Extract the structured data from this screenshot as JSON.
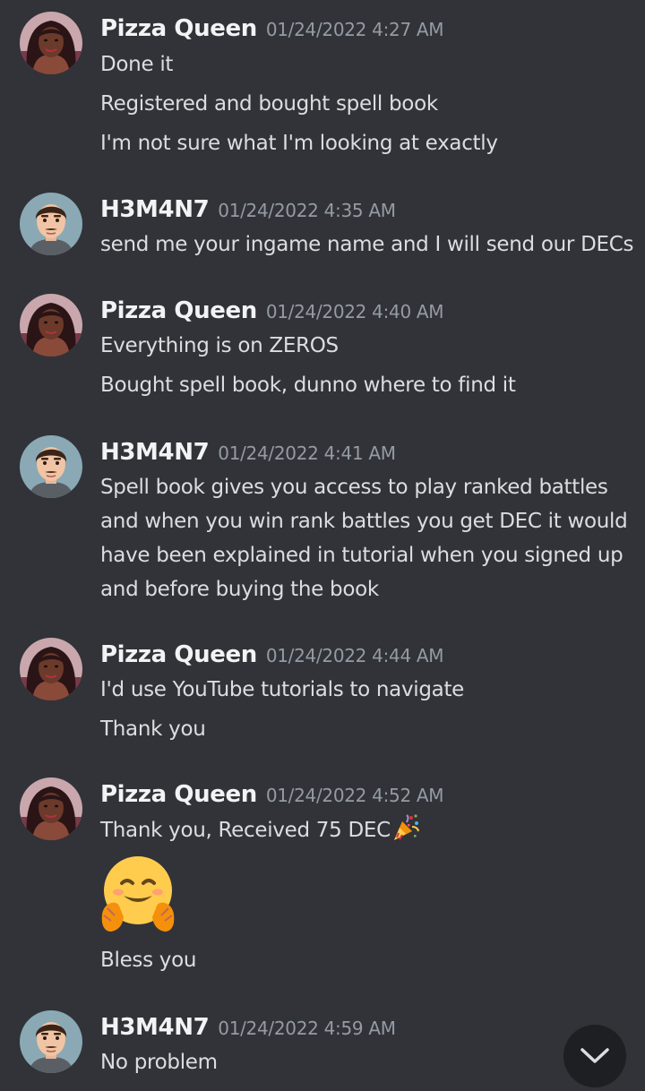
{
  "messages": [
    {
      "user": "Pizza Queen",
      "avatar": "woman-avatar",
      "timestamp": "01/24/2022 4:27 AM",
      "lines": [
        "Done it",
        "Registered and bought spell book",
        "I'm not sure what I'm looking at exactly"
      ]
    },
    {
      "user": "H3M4N7",
      "avatar": "man-avatar",
      "timestamp": "01/24/2022 4:35 AM",
      "lines": [
        "send me your ingame name and I will send our DECs"
      ]
    },
    {
      "user": "Pizza Queen",
      "avatar": "woman-avatar",
      "timestamp": "01/24/2022 4:40 AM",
      "lines": [
        "Everything is on ZEROS",
        "Bought spell book, dunno where to find it"
      ]
    },
    {
      "user": "H3M4N7",
      "avatar": "man-avatar",
      "timestamp": "01/24/2022 4:41 AM",
      "lines": [
        "Spell book gives you access to play ranked battles",
        "and when you win rank battles you get DEC it would",
        "have been explained in tutorial when you signed up",
        "and before buying the book"
      ]
    },
    {
      "user": "Pizza Queen",
      "avatar": "woman-avatar",
      "timestamp": "01/24/2022 4:44 AM",
      "lines": [
        "I'd use YouTube tutorials to navigate",
        "Thank you"
      ]
    },
    {
      "user": "Pizza Queen",
      "avatar": "woman-avatar",
      "timestamp": "01/24/2022 4:52 AM",
      "lines": [
        "Thank you, Received 75 DEC",
        "Bless you"
      ],
      "emojis": [
        "party-popper-emoji",
        "hugging-face-emoji"
      ]
    },
    {
      "user": "H3M4N7",
      "avatar": "man-avatar",
      "timestamp": "01/24/2022 4:59 AM",
      "lines": [
        "No problem"
      ]
    }
  ],
  "controls": {
    "scroll_button_icon": "chevron-down-icon"
  },
  "colors": {
    "background": "#313338",
    "username": "#f2f3f5",
    "timestamp": "#949ba4",
    "text": "#dbdee1",
    "scroll_button": "#1e1f22"
  }
}
